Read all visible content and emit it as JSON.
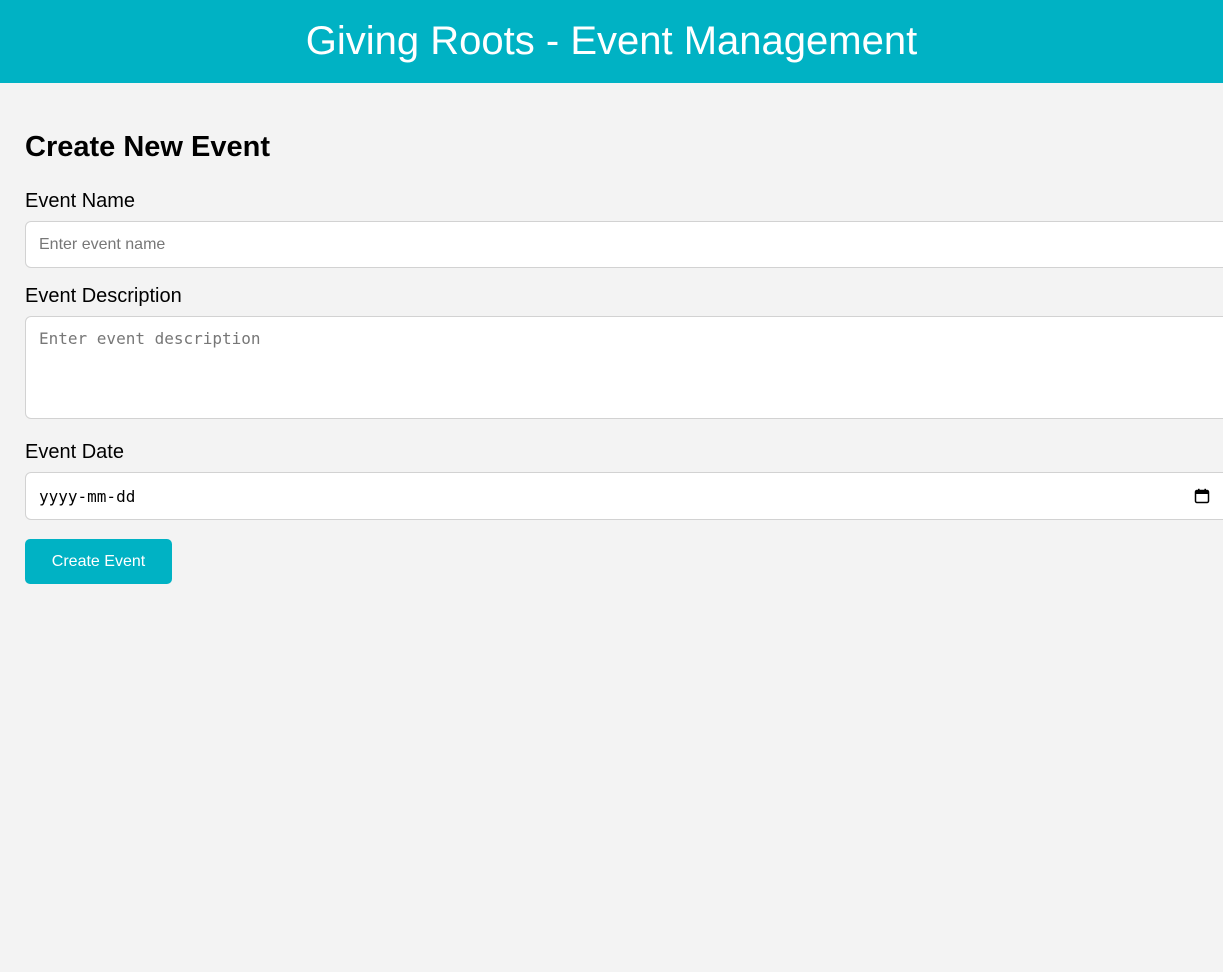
{
  "header": {
    "title": "Giving Roots - Event Management"
  },
  "form": {
    "title": "Create New Event",
    "event_name": {
      "label": "Event Name",
      "placeholder": "Enter event name",
      "value": ""
    },
    "event_description": {
      "label": "Event Description",
      "placeholder": "Enter event description",
      "value": ""
    },
    "event_date": {
      "label": "Event Date",
      "placeholder": "yyyy-mm-dd",
      "icon": "calendar-icon"
    },
    "submit_label": "Create Event"
  },
  "colors": {
    "accent": "#00b2c4",
    "background": "#f3f3f3"
  }
}
